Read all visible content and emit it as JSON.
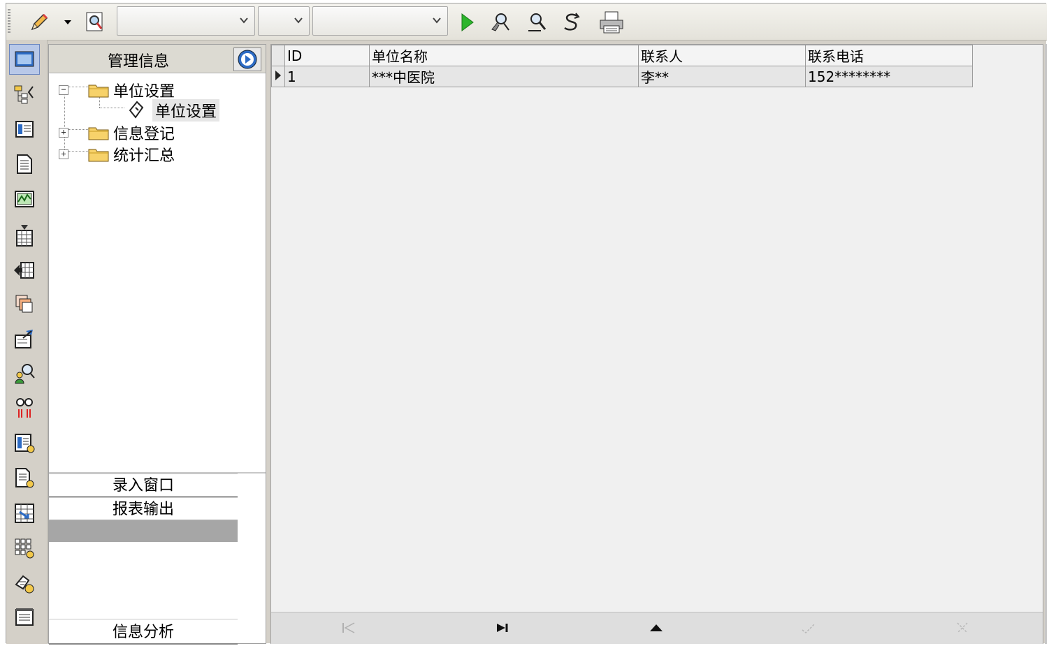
{
  "toolbar": {
    "icons": [
      "pencil-icon",
      "dropdown-caret-icon",
      "preview-icon",
      "run-icon",
      "find-icon",
      "find-next-icon",
      "refresh-icon",
      "print-icon"
    ],
    "combo1_value": "",
    "combo2_value": "",
    "combo3_value": "",
    "run_color": "#2cb52c"
  },
  "strip": {
    "icons": [
      "window-icon",
      "tree-diagram-icon",
      "list-view-icon",
      "document-icon",
      "chart-icon",
      "calendar-check-icon",
      "arrow-grid-icon",
      "layers-icon",
      "form-edit-icon",
      "user-search-icon",
      "people-icon",
      "report-icon",
      "document-report-icon",
      "table-export-icon",
      "grid-settings-icon",
      "user-settings-icon",
      "notes-icon"
    ],
    "active": "window-icon"
  },
  "nav": {
    "title": "管理信息",
    "tree": [
      {
        "label": "单位设置",
        "expanded": true,
        "children": [
          {
            "label": "单位设置",
            "selected": true
          }
        ]
      },
      {
        "label": "信息登记",
        "expanded": false
      },
      {
        "label": "统计汇总",
        "expanded": false
      }
    ],
    "sections": [
      "录入窗口",
      "报表输出"
    ],
    "bottom_section": "信息分析"
  },
  "grid": {
    "columns": [
      "ID",
      "单位名称",
      "联系人",
      "联系电话"
    ],
    "rows": [
      {
        "id": "1",
        "name": "***中医院",
        "contact": "李**",
        "phone": "152********"
      }
    ]
  },
  "navigator": {
    "buttons": [
      {
        "name": "first-record-icon",
        "enabled": false
      },
      {
        "name": "last-record-icon",
        "enabled": true
      },
      {
        "name": "insert-record-icon",
        "enabled": true
      },
      {
        "name": "post-record-icon",
        "enabled": false
      },
      {
        "name": "cancel-record-icon",
        "enabled": false
      }
    ]
  }
}
